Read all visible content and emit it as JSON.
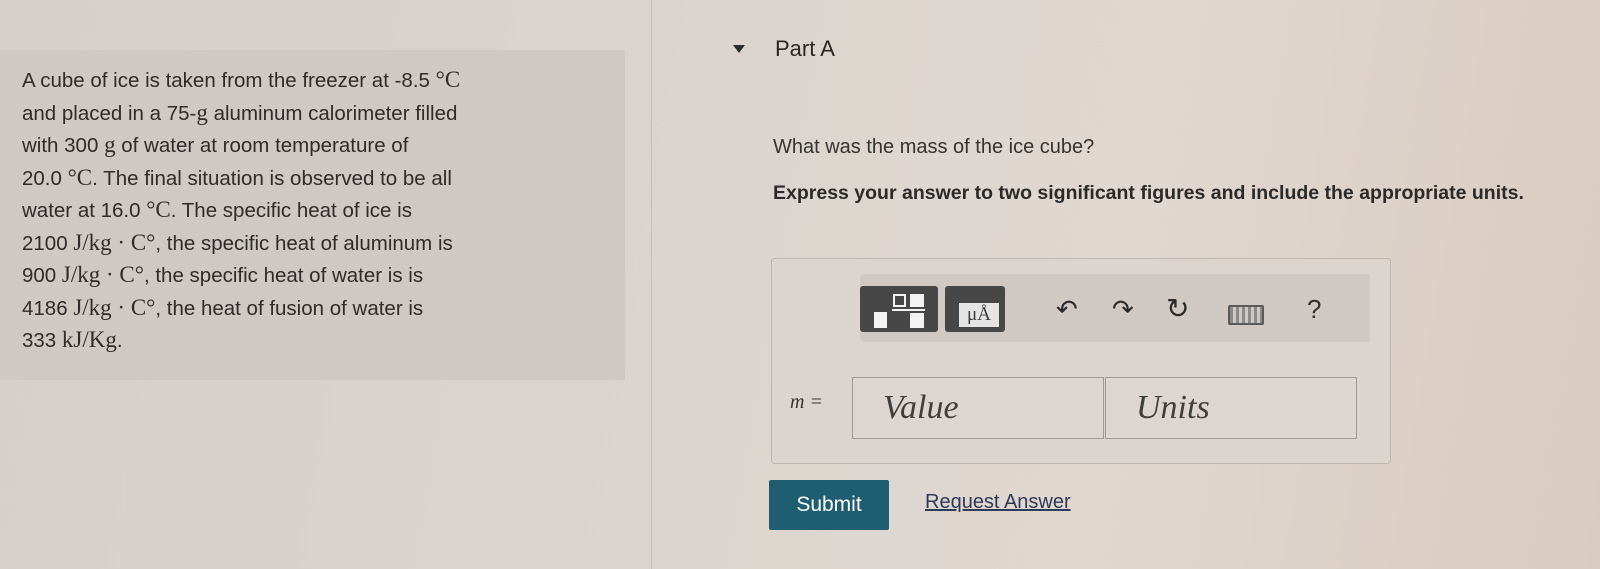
{
  "problem": {
    "line1_text": "A cube of ice is taken from the freezer at -8.5 ",
    "line1_math": "°C",
    "line2_text_a": "and placed in a 75-",
    "line2_math": "g",
    "line2_text_b": " aluminum calorimeter filled",
    "line3_text_a": "with 300  ",
    "line3_math": "g",
    "line3_text_b": " of water at room temperature of",
    "line4_text_a": "20.0 ",
    "line4_math": "°C",
    "line4_text_b": ". The final situation is observed to be all",
    "line5_text_a": "water at 16.0 ",
    "line5_math": "°C",
    "line5_text_b": ". The specific heat of ice is",
    "line6_text_a": "2100 ",
    "line6_math": "J/kg · C°",
    "line6_text_b": ", the specific heat of aluminum is",
    "line7_text_a": "900 ",
    "line7_math": "J/kg · C°",
    "line7_text_b": ", the specific heat of water is is",
    "line8_text_a": "4186 ",
    "line8_math": "J/kg · C°",
    "line8_text_b": ", the heat of fusion of water is",
    "line9_text_a": "333 ",
    "line9_math": "kJ/Kg",
    "line9_text_b": "."
  },
  "part": {
    "title": "Part A"
  },
  "question": "What was the mass of the ice cube?",
  "instructions": "Express your answer to two significant figures and include the appropriate units.",
  "toolbar": {
    "units_label": "μÅ",
    "undo_glyph": "↶",
    "redo_glyph": "↷",
    "reset_glyph": "↻",
    "help_glyph": "?",
    "icons": [
      "templates-icon",
      "units-icon",
      "undo-icon",
      "redo-icon",
      "reset-icon",
      "keyboard-icon",
      "help-icon"
    ]
  },
  "answer": {
    "variable_label": "m =",
    "value_placeholder": "Value",
    "units_placeholder": "Units"
  },
  "actions": {
    "submit_label": "Submit",
    "request_answer_label": "Request Answer"
  },
  "colors": {
    "submit_bg": "#1f5e70",
    "link": "#2e3a55"
  }
}
